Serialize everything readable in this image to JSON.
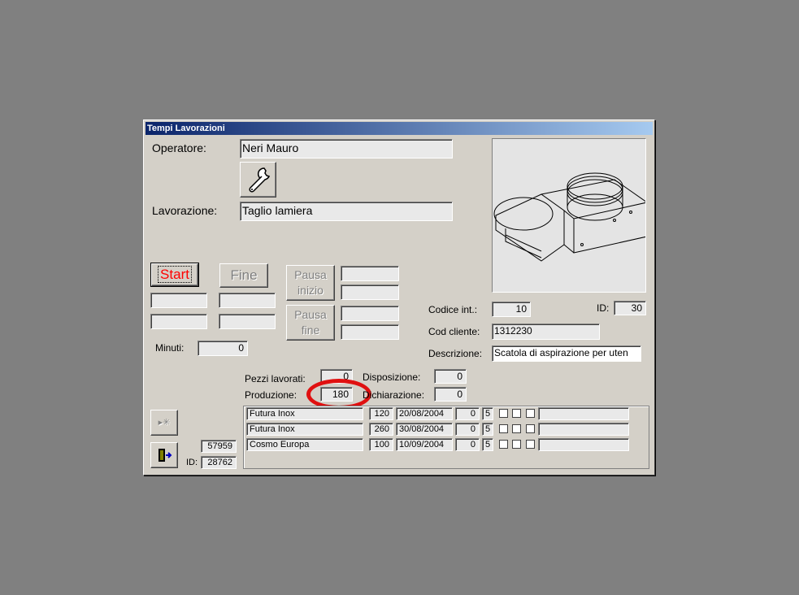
{
  "window": {
    "title": "Tempi Lavorazioni"
  },
  "operator": {
    "label": "Operatore:",
    "value": "Neri Mauro"
  },
  "processing": {
    "label": "Lavorazione:",
    "value": "Taglio lamiera"
  },
  "timing": {
    "start_label": "Start",
    "end_label": "Fine",
    "pause_start_label": "Pausa inizio",
    "pause_end_label": "Pausa fine",
    "minutes_label": "Minuti:",
    "minutes_value": "0"
  },
  "product": {
    "internal_code_label": "Codice  int.:",
    "internal_code_value": "10",
    "id_label": "ID:",
    "id_value": "30",
    "client_code_label": "Cod cliente:",
    "client_code_value": "1312230",
    "description_label": "Descrizione:",
    "description_value": "Scatola di aspirazione per uten"
  },
  "counts": {
    "pieces_label": "Pezzi lavorati:",
    "pieces_value": "0",
    "production_label": "Produzione:",
    "production_value": "180",
    "disposition_label": "Disposizione:",
    "disposition_value": "0",
    "declaration_label": "Dichiarazione:",
    "declaration_value": "0"
  },
  "record": {
    "number": "57959",
    "id_label": "ID:",
    "id_value": "28762"
  },
  "orders": [
    {
      "client": "Futura Inox",
      "qty": "120",
      "date": "20/08/2004",
      "a": "0",
      "b": "5"
    },
    {
      "client": "Futura Inox",
      "qty": "260",
      "date": "30/08/2004",
      "a": "0",
      "b": "5"
    },
    {
      "client": "Cosmo Europa",
      "qty": "100",
      "date": "10/09/2004",
      "a": "0",
      "b": "5"
    }
  ],
  "colors": {
    "titlebar_start": "#0a246a",
    "start_text": "#ff0000",
    "highlight_ring": "#e01010"
  }
}
